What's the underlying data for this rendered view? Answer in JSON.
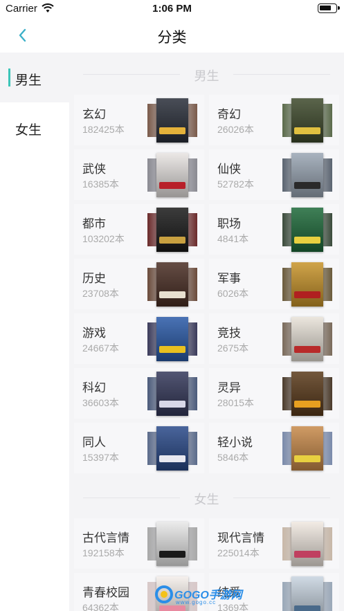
{
  "status_bar": {
    "carrier": "Carrier",
    "time": "1:06 PM"
  },
  "nav": {
    "title": "分类"
  },
  "sidebar": {
    "items": [
      {
        "label": "男生",
        "active": true
      },
      {
        "label": "女生",
        "active": false
      }
    ]
  },
  "sections": [
    {
      "title": "男生",
      "categories": [
        {
          "name": "玄幻",
          "count": "182425本",
          "cover_back": "#7a5a4a",
          "cover_front": "#2a2f3a",
          "cover_strip": "#e4b23a"
        },
        {
          "name": "奇幻",
          "count": "26026本",
          "cover_back": "#5a6a4a",
          "cover_front": "#3e4a2c",
          "cover_strip": "#e0c040"
        },
        {
          "name": "武侠",
          "count": "16385本",
          "cover_back": "#8a8a92",
          "cover_front": "#e8e4e2",
          "cover_strip": "#b8202a"
        },
        {
          "name": "仙侠",
          "count": "52782本",
          "cover_back": "#5a6470",
          "cover_front": "#9aa6b4",
          "cover_strip": "#2a2a2a"
        },
        {
          "name": "都市",
          "count": "103202本",
          "cover_back": "#6a2a2a",
          "cover_front": "#1a1a1a",
          "cover_strip": "#c8a040"
        },
        {
          "name": "职场",
          "count": "4841本",
          "cover_back": "#3a4a3a",
          "cover_front": "#1e6a3a",
          "cover_strip": "#e8d040"
        },
        {
          "name": "历史",
          "count": "23708本",
          "cover_back": "#6a4a3a",
          "cover_front": "#4a2e24",
          "cover_strip": "#e8e0d0"
        },
        {
          "name": "军事",
          "count": "6026本",
          "cover_back": "#6a5a3a",
          "cover_front": "#c8942a",
          "cover_strip": "#b02020"
        },
        {
          "name": "游戏",
          "count": "24667本",
          "cover_back": "#3a3a5a",
          "cover_front": "#2a5aa8",
          "cover_strip": "#e8c020"
        },
        {
          "name": "竞技",
          "count": "2675本",
          "cover_back": "#7a6a5a",
          "cover_front": "#e8e2d8",
          "cover_strip": "#b82a2a"
        },
        {
          "name": "科幻",
          "count": "36603本",
          "cover_back": "#4a5a7a",
          "cover_front": "#34385a",
          "cover_strip": "#d8d8e8"
        },
        {
          "name": "灵异",
          "count": "28015本",
          "cover_back": "#4a3a2a",
          "cover_front": "#5a3a1a",
          "cover_strip": "#e8a020"
        },
        {
          "name": "同人",
          "count": "15397本",
          "cover_back": "#5a6a8a",
          "cover_front": "#2a4a8a",
          "cover_strip": "#e8e8f0"
        },
        {
          "name": "轻小说",
          "count": "5846本",
          "cover_back": "#7a8aaa",
          "cover_front": "#c88a4a",
          "cover_strip": "#e8d040"
        }
      ]
    },
    {
      "title": "女生",
      "categories": [
        {
          "name": "古代言情",
          "count": "192158本",
          "cover_back": "#a8a8a8",
          "cover_front": "#e8e8e8",
          "cover_strip": "#1a1a1a"
        },
        {
          "name": "现代言情",
          "count": "225014本",
          "cover_back": "#c8b8a8",
          "cover_front": "#f0e8e0",
          "cover_strip": "#c04060"
        },
        {
          "name": "青春校园",
          "count": "64362本",
          "cover_back": "#d8c8c8",
          "cover_front": "#f4eeea",
          "cover_strip": "#e88aa0"
        },
        {
          "name": "纯爱",
          "count": "1369本",
          "cover_back": "#9aa8b8",
          "cover_front": "#c8d4e0",
          "cover_strip": "#4a6a8a"
        }
      ]
    }
  ],
  "watermark": {
    "brand": "GOGO手游网",
    "url": "www.gogo.cc"
  },
  "colors": {
    "accent": "#3cc5b8",
    "content_bg": "#f4f4f6",
    "card_bg": "#f7f7f9",
    "section_title": "#c8c8cc"
  }
}
